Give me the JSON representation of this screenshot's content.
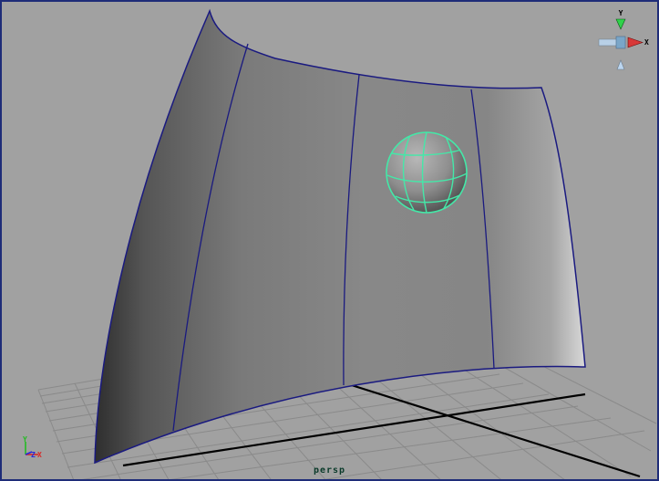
{
  "viewport": {
    "camera_label": "persp",
    "view_cube": {
      "y_label": "Y",
      "x_label": "X"
    },
    "axis_gizmo": {
      "y_label": "Y",
      "z_label": "Z",
      "x_label": "X"
    }
  },
  "colors": {
    "background": "#a1a1a1",
    "border": "#1e2c78",
    "grid": "#8a8a8a",
    "grid_axis": "#000000",
    "surface_isoparm": "#1a1a80",
    "selection_wireframe": "#44e8a8"
  }
}
